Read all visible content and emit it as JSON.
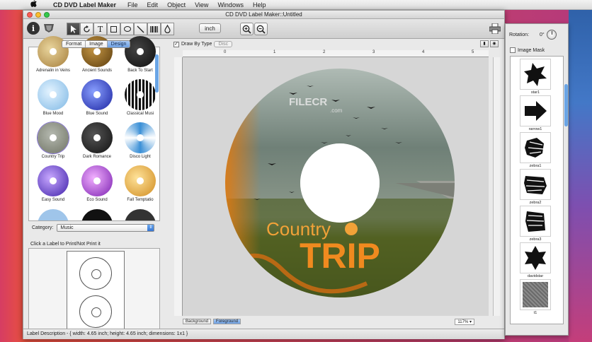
{
  "menubar": {
    "apple": "",
    "app_name": "CD DVD Label Maker",
    "items": [
      "File",
      "Edit",
      "Object",
      "View",
      "Windows",
      "Help"
    ]
  },
  "window": {
    "title": "CD DVD Label Maker::Untitled"
  },
  "toolbar": {
    "unit_button": "inch",
    "tools": [
      "select-tool",
      "rotate-tool",
      "text-tool",
      "rect-tool",
      "ellipse-tool",
      "line-tool",
      "barcode-tool",
      "fill-tool"
    ]
  },
  "left_panel": {
    "tabs": [
      "Format",
      "Image",
      "Design"
    ],
    "active_tab": "Design",
    "designs": [
      {
        "label": "Adrenalin in Veins",
        "color": "#c9a25a"
      },
      {
        "label": "Ancient Sounds",
        "color": "#7a5a1c"
      },
      {
        "label": "Back To Start",
        "color": "#1b1b1b"
      },
      {
        "label": "Blue Mood",
        "color": "#9fd1f0"
      },
      {
        "label": "Blue Sound",
        "color": "#2b3fc2"
      },
      {
        "label": "Classical Musi",
        "color": "#222222"
      },
      {
        "label": "Country Trip",
        "color": "#8a8f7a"
      },
      {
        "label": "Dark Romance",
        "color": "#2a2a2a"
      },
      {
        "label": "Disco Light",
        "color": "#6fb7e6"
      },
      {
        "label": "Easy Sound",
        "color": "#6a3fd0"
      },
      {
        "label": "Eco Sound",
        "color": "#b23fd8"
      },
      {
        "label": "Fall Temptatio",
        "color": "#e6b040"
      }
    ],
    "category_label": "Category:",
    "category_value": "Music",
    "click_hint": "Click a Label to Print/Not Print it"
  },
  "canvas": {
    "draw_by_type_label": "Draw By Type",
    "draw_by_type_checked": true,
    "disc_button": "Disc",
    "ruler_ticks": [
      "0",
      "1",
      "2",
      "3",
      "4",
      "5"
    ],
    "layer_tabs": [
      "Background",
      "Foreground"
    ],
    "active_layer": "Foreground",
    "zoom": "117%",
    "label": {
      "line1": "Country",
      "line2": "TRIP",
      "watermark": "FILECR",
      "watermark_sub": ".com"
    }
  },
  "status": {
    "text": "Label Description - { width: 4.65 inch; height: 4.65 inch; dimensions: 1x1 }"
  },
  "right_panel": {
    "rotation_label": "Rotation:",
    "rotation_value": "0°",
    "image_mask_label": "Image Mask",
    "shapes": [
      {
        "label": "star1",
        "icon": "star-shape-icon"
      },
      {
        "label": "rarrow1",
        "icon": "right-arrow-shape-icon"
      },
      {
        "label": "zebra1",
        "icon": "zebra-shape-icon"
      },
      {
        "label": "zebra2",
        "icon": "zebra-shape-icon"
      },
      {
        "label": "zebra3",
        "icon": "zebra-shape-icon"
      },
      {
        "label": "davidstar",
        "icon": "davidstar-shape-icon"
      },
      {
        "label": "t1",
        "icon": "texture-shape-icon"
      }
    ]
  }
}
